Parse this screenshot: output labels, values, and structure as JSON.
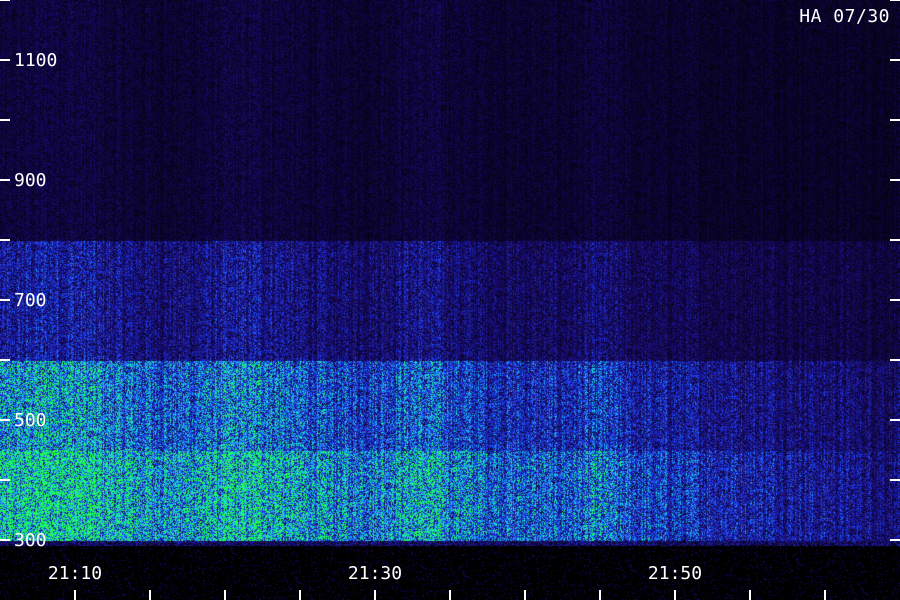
{
  "header": {
    "station_label": "HA 07/30"
  },
  "colors": {
    "background": "#000000",
    "low": "#1a0a6e",
    "mid": "#2040ff",
    "high_cyan": "#19d7e6",
    "peak_green": "#22ff44",
    "axis": "#ffffff"
  },
  "chart_data": {
    "type": "heatmap",
    "title": "",
    "xlabel": "",
    "ylabel": "",
    "x_ticks_labeled": [
      "21:10",
      "21:30",
      "21:50"
    ],
    "x_range": [
      "21:05",
      "22:05"
    ],
    "x_minor_tick_step_min": 5,
    "y_ticks_labeled": [
      300,
      500,
      700,
      900,
      1100
    ],
    "y_minor_ticks": [
      400,
      600,
      800,
      1000,
      1200
    ],
    "ylim": [
      300,
      1200
    ],
    "colorscale": [
      "#000000",
      "#1a0a6e",
      "#2040ff",
      "#19d7e6",
      "#22ff44"
    ],
    "intensity_profile": {
      "description_units": "relative intensity 0-1 by frequency band (Hz) and time",
      "bands": [
        {
          "freq_from": 300,
          "freq_to": 450,
          "early": 0.9,
          "middle": 0.75,
          "late": 0.35
        },
        {
          "freq_from": 450,
          "freq_to": 600,
          "early": 0.7,
          "middle": 0.55,
          "late": 0.3
        },
        {
          "freq_from": 600,
          "freq_to": 800,
          "early": 0.35,
          "middle": 0.3,
          "late": 0.2
        },
        {
          "freq_from": 800,
          "freq_to": 1200,
          "early": 0.15,
          "middle": 0.15,
          "late": 0.12
        }
      ]
    }
  }
}
